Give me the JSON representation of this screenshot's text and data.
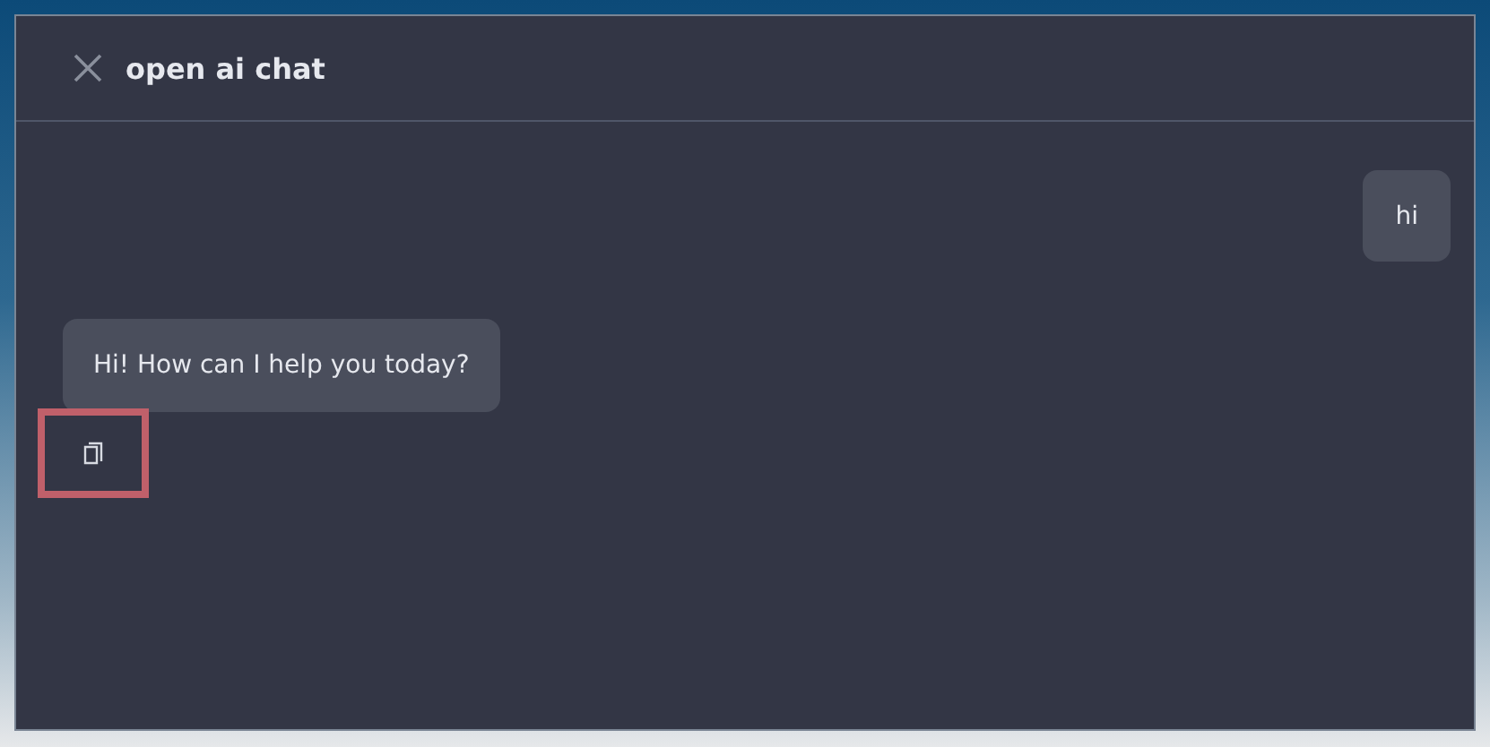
{
  "dialog": {
    "title": "open ai chat"
  },
  "messages": [
    {
      "kind": "user",
      "text": "hi"
    },
    {
      "kind": "assistant",
      "text": "Hi! How can I help you today?",
      "copy_highlighted": true
    }
  ]
}
